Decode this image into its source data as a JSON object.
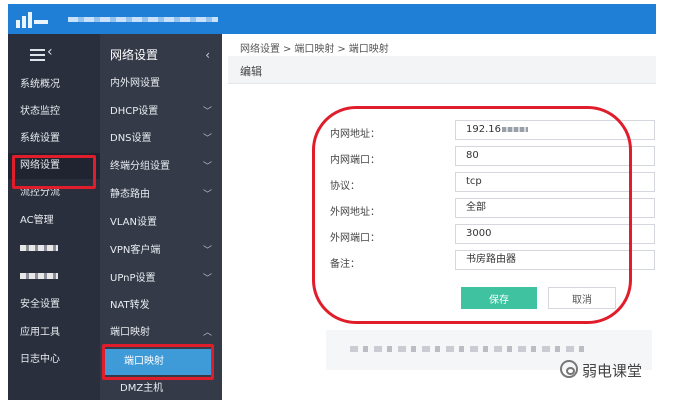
{
  "topbar": {
    "brand_color": "#1f7fd6",
    "logo_icon": "signal-bars-logo"
  },
  "sidebar": {
    "items": [
      {
        "label": "系统概况"
      },
      {
        "label": "状态监控"
      },
      {
        "label": "系统设置"
      },
      {
        "label": "网络设置",
        "active": true
      },
      {
        "label": "流控分流"
      },
      {
        "label": "AC管理"
      },
      {
        "label": ""
      },
      {
        "label": ""
      },
      {
        "label": "安全设置"
      },
      {
        "label": "应用工具"
      },
      {
        "label": "日志中心"
      }
    ]
  },
  "submenu": {
    "title": "网络设置",
    "items": [
      {
        "label": "内外网设置"
      },
      {
        "label": "DHCP设置"
      },
      {
        "label": "DNS设置"
      },
      {
        "label": "终端分组设置"
      },
      {
        "label": "静态路由"
      },
      {
        "label": "VLAN设置"
      },
      {
        "label": "VPN客户端"
      },
      {
        "label": "UPnP设置"
      },
      {
        "label": "NAT转发"
      },
      {
        "label": "端口映射"
      },
      {
        "label": "端口映射",
        "selected": true
      },
      {
        "label": "DMZ主机"
      }
    ]
  },
  "breadcrumb": [
    "网络设置",
    "端口映射",
    "端口映射"
  ],
  "breadcrumb_separator": ">",
  "panel_title": "编辑",
  "form": {
    "fields": [
      {
        "label": "内网地址：",
        "value": "192.16"
      },
      {
        "label": "内网端口：",
        "value": "80"
      },
      {
        "label": "协议：",
        "value": "tcp"
      },
      {
        "label": "外网地址：",
        "value": "全部"
      },
      {
        "label": "外网端口：",
        "value": "3000"
      },
      {
        "label": "备注：",
        "value": "书房路由器"
      }
    ],
    "save_label": "保存",
    "cancel_label": "取消"
  },
  "watermark": {
    "text": "弱电课堂",
    "icon": "chat-bubble-icon"
  },
  "colors": {
    "highlight": "#e01d2b",
    "save_button": "#3fc2a0",
    "selected_item": "#3f9ad8"
  }
}
